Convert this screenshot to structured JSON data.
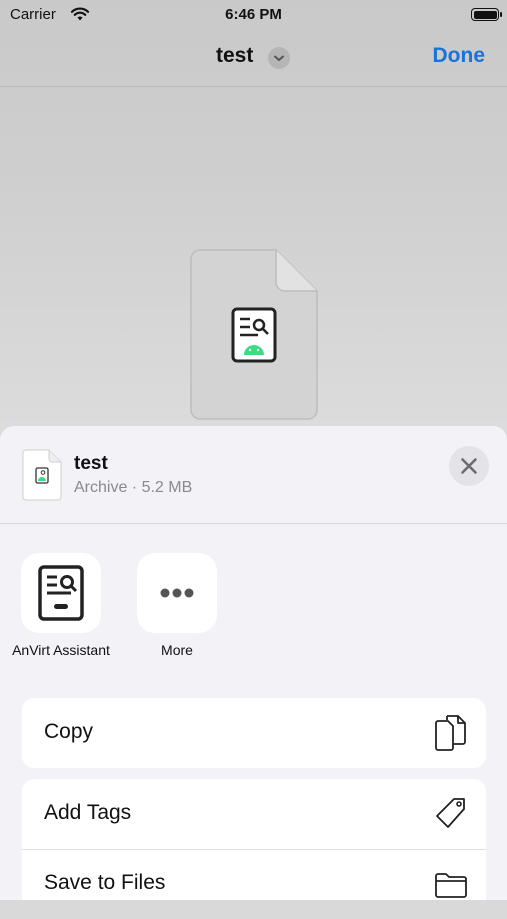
{
  "status_bar": {
    "carrier": "Carrier",
    "time": "6:46 PM"
  },
  "nav": {
    "title": "test",
    "done_label": "Done"
  },
  "share_sheet": {
    "file_name": "test",
    "file_meta": "Archive · 5.2 MB",
    "apps": [
      {
        "label": "AnVirt Assistant",
        "icon": "anvirt-app-icon"
      },
      {
        "label": "More",
        "icon": "more-dots-icon"
      }
    ],
    "actions": [
      {
        "label": "Copy",
        "icon": "copy-icon"
      },
      {
        "label": "Add Tags",
        "icon": "tag-icon"
      },
      {
        "label": "Save to Files",
        "icon": "folder-icon"
      }
    ]
  },
  "colors": {
    "accent": "#1a73d9",
    "android_green": "#3ddc84"
  }
}
